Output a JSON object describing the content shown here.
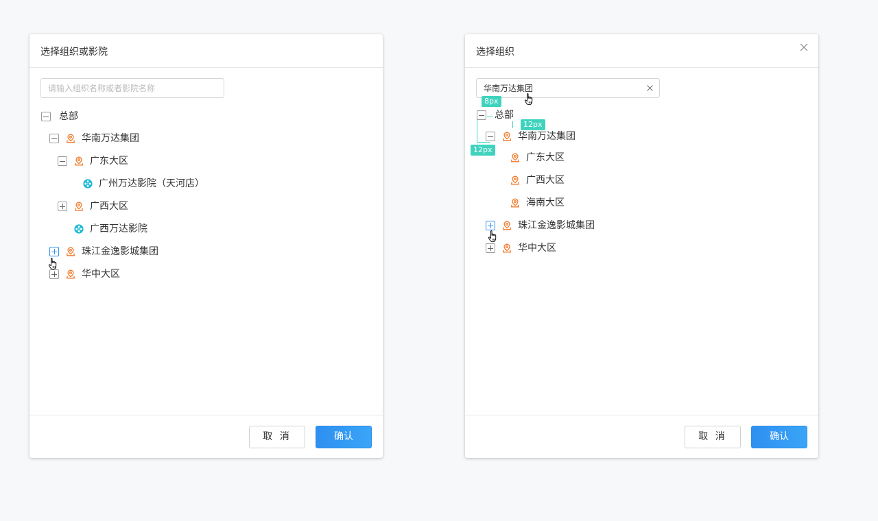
{
  "left_dialog": {
    "title": "选择组织或影院",
    "search": {
      "placeholder": "请输入组织名称或者影院名称",
      "value": ""
    },
    "tree": [
      {
        "label": "总部",
        "toggle": "minus",
        "icon": "none"
      },
      {
        "label": "华南万达集团",
        "toggle": "minus",
        "icon": "location-icon"
      },
      {
        "label": "广东大区",
        "toggle": "minus",
        "icon": "location-icon"
      },
      {
        "label": "广州万达影院（天河店）",
        "toggle": "none",
        "icon": "film-reel-icon"
      },
      {
        "label": "广西大区",
        "toggle": "plus",
        "icon": "location-icon"
      },
      {
        "label": "广西万达影院",
        "toggle": "none",
        "icon": "film-reel-icon"
      },
      {
        "label": "珠江金逸影城集团",
        "toggle": "plus",
        "icon": "location-icon"
      },
      {
        "label": "华中大区",
        "toggle": "plus",
        "icon": "location-icon"
      }
    ],
    "cancel_label": "取 消",
    "ok_label": "确认"
  },
  "right_dialog": {
    "title": "选择组织",
    "search": {
      "placeholder": "",
      "value": "华南万达集团"
    },
    "tree": [
      {
        "label": "总部",
        "toggle": "minus",
        "icon": "none"
      },
      {
        "label": "华南万达集团",
        "toggle": "minus",
        "icon": "location-icon"
      },
      {
        "label": "广东大区",
        "toggle": "none",
        "icon": "location-icon"
      },
      {
        "label": "广西大区",
        "toggle": "none",
        "icon": "location-icon"
      },
      {
        "label": "海南大区",
        "toggle": "none",
        "icon": "location-icon"
      },
      {
        "label": "珠江金逸影城集团",
        "toggle": "plus",
        "icon": "location-icon"
      },
      {
        "label": "华中大区",
        "toggle": "plus",
        "icon": "location-icon"
      }
    ],
    "cancel_label": "取 消",
    "ok_label": "确认"
  },
  "spec_annotations": {
    "tag_1": "8px",
    "tag_2": "12px",
    "tag_3": "12px"
  },
  "colors": {
    "primary": "#2e8ff0",
    "location_icon": "#f07a2a",
    "film_icon": "#18b8d6",
    "spec_annotation": "#3fd3be",
    "border": "#e6e6e6"
  }
}
